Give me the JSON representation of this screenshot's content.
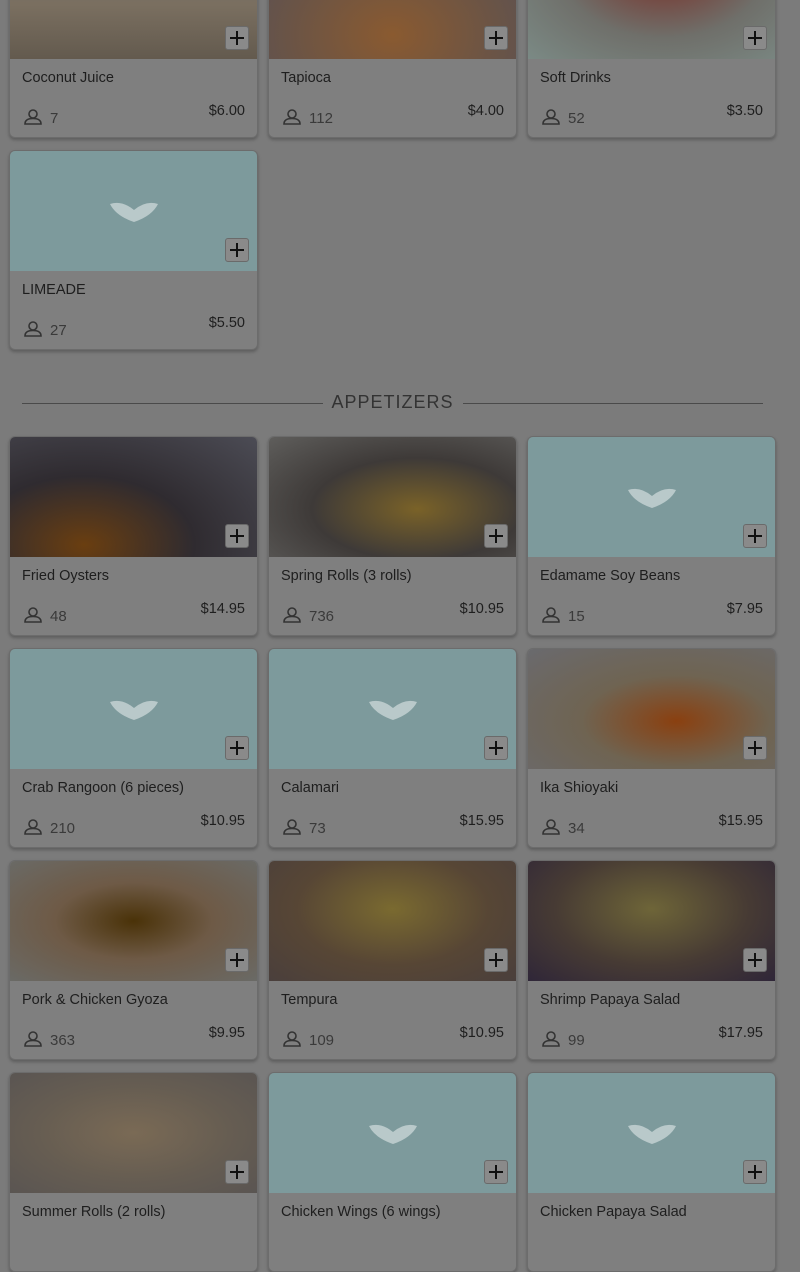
{
  "drinks_partial": [
    {
      "name": "Coconut Juice",
      "count": "7",
      "price": "$6.00",
      "image": "photo"
    },
    {
      "name": "Tapioca",
      "count": "112",
      "price": "$4.00",
      "image": "photo"
    },
    {
      "name": "Soft Drinks",
      "count": "52",
      "price": "$3.50",
      "image": "photo"
    },
    {
      "name": "LIMEADE",
      "count": "27",
      "price": "$5.50",
      "image": "placeholder"
    }
  ],
  "section": {
    "title": "APPETIZERS"
  },
  "appetizers": [
    {
      "name": "Fried Oysters",
      "count": "48",
      "price": "$14.95",
      "image": "photo"
    },
    {
      "name": "Spring Rolls (3 rolls)",
      "count": "736",
      "price": "$10.95",
      "image": "photo"
    },
    {
      "name": "Edamame Soy Beans",
      "count": "15",
      "price": "$7.95",
      "image": "placeholder"
    },
    {
      "name": "Crab Rangoon (6 pieces)",
      "count": "210",
      "price": "$10.95",
      "image": "placeholder"
    },
    {
      "name": "Calamari",
      "count": "73",
      "price": "$15.95",
      "image": "placeholder"
    },
    {
      "name": "Ika Shioyaki",
      "count": "34",
      "price": "$15.95",
      "image": "photo"
    },
    {
      "name": "Pork & Chicken Gyoza",
      "count": "363",
      "price": "$9.95",
      "image": "photo"
    },
    {
      "name": "Tempura",
      "count": "109",
      "price": "$10.95",
      "image": "photo"
    },
    {
      "name": "Shrimp Papaya Salad",
      "count": "99",
      "price": "$17.95",
      "image": "photo"
    },
    {
      "name": "Summer Rolls (2 rolls)",
      "count": "",
      "price": "",
      "image": "photo"
    },
    {
      "name": "Chicken Wings (6 wings)",
      "count": "",
      "price": "",
      "image": "placeholder"
    },
    {
      "name": "Chicken Papaya Salad",
      "count": "",
      "price": "",
      "image": "placeholder"
    }
  ],
  "icons": {
    "add": "plus-icon",
    "count": "user-icon",
    "placeholder": "fish-logo-icon"
  },
  "colors": {
    "overlay_dim": "#7b7b7b",
    "placeholder_bg": "#7d9a9c"
  }
}
